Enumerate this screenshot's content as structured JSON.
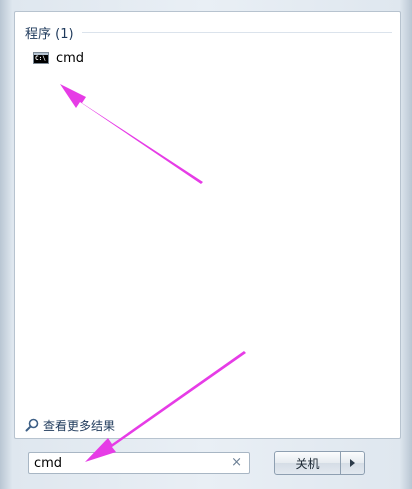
{
  "results": {
    "group_title": "程序 (1)",
    "items": [
      {
        "label": "cmd",
        "icon": "cmd-console-icon"
      }
    ]
  },
  "see_more": {
    "label": "查看更多结果",
    "icon": "search-icon"
  },
  "search": {
    "value": "cmd",
    "clear_icon": "×"
  },
  "shutdown": {
    "label": "关机",
    "arrow_icon": "triangle-right-icon"
  },
  "colors": {
    "annotation_arrow": "#e63ce6",
    "group_title": "#1e395b",
    "panel_border": "#b7c3cf"
  }
}
